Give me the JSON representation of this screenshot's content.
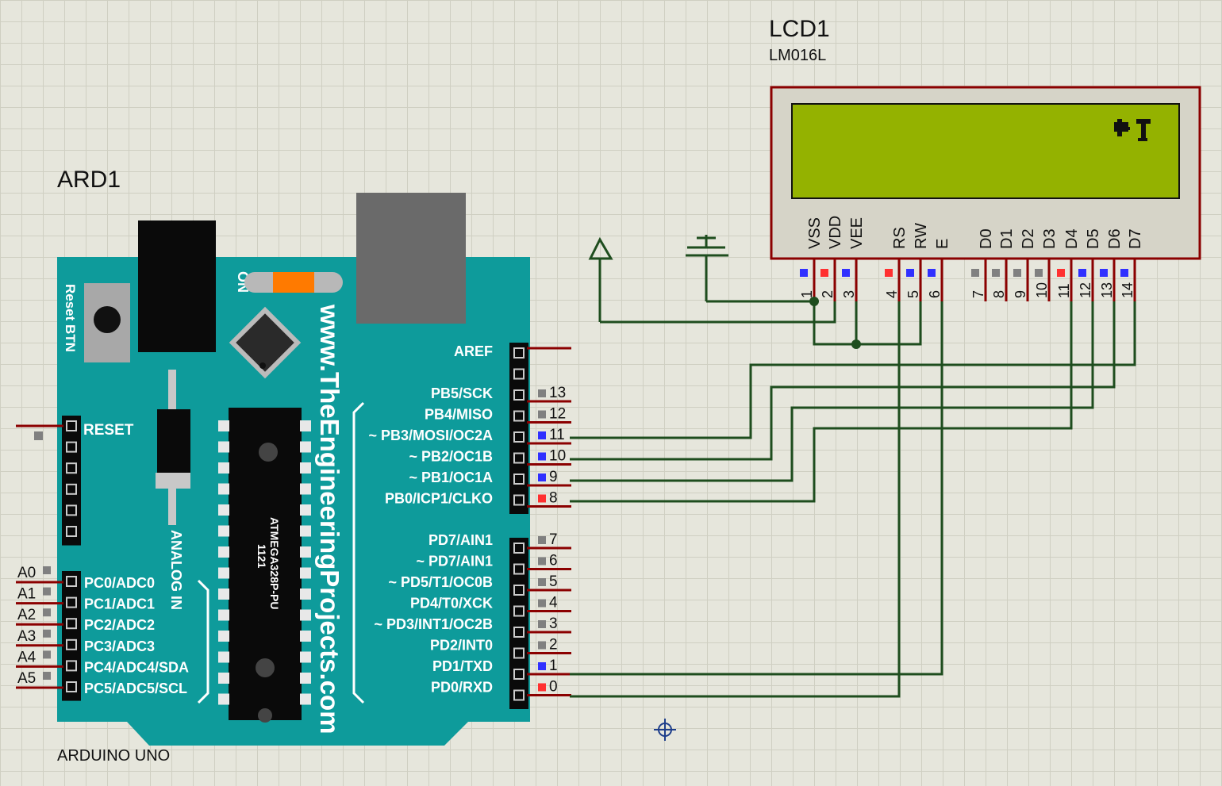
{
  "arduino": {
    "ref": "ARD1",
    "model": "ARDUINO UNO",
    "reset_btn": "Reset BTN",
    "power_label": "ON",
    "website": "www.TheEngineeringProjects.com",
    "chip_line1": "1121",
    "chip_line2": "ATMEGA328P-PU",
    "analog_in": "ANALOG IN",
    "reset_pin": "RESET",
    "digital_header_top": [
      {
        "label": "AREF",
        "num": ""
      },
      {
        "label": "",
        "num": ""
      },
      {
        "label": "PB5/SCK",
        "num": "13"
      },
      {
        "label": "PB4/MISO",
        "num": "12"
      },
      {
        "label": "~ PB3/MOSI/OC2A",
        "num": "11"
      },
      {
        "label": "~ PB2/OC1B",
        "num": "10"
      },
      {
        "label": "~ PB1/OC1A",
        "num": "9"
      },
      {
        "label": "PB0/ICP1/CLKO",
        "num": "8"
      }
    ],
    "digital_header_bottom": [
      {
        "label": "PD7/AIN1",
        "num": "7"
      },
      {
        "label": "~ PD7/AIN1",
        "num": "6"
      },
      {
        "label": "~ PD5/T1/OC0B",
        "num": "5"
      },
      {
        "label": "PD4/T0/XCK",
        "num": "4"
      },
      {
        "label": "~ PD3/INT1/OC2B",
        "num": "3"
      },
      {
        "label": "PD2/INT0",
        "num": "2"
      },
      {
        "label": "PD1/TXD",
        "num": "1"
      },
      {
        "label": "PD0/RXD",
        "num": "0"
      }
    ],
    "analog_header": [
      {
        "label": "PC0/ADC0",
        "num": "A0"
      },
      {
        "label": "PC1/ADC1",
        "num": "A1"
      },
      {
        "label": "PC2/ADC2",
        "num": "A2"
      },
      {
        "label": "PC3/ADC3",
        "num": "A3"
      },
      {
        "label": "PC4/ADC4/SDA",
        "num": "A4"
      },
      {
        "label": "PC5/ADC5/SCL",
        "num": "A5"
      }
    ]
  },
  "lcd": {
    "ref": "LCD1",
    "model": "LM016L",
    "pins": [
      {
        "name": "VSS",
        "num": "1"
      },
      {
        "name": "VDD",
        "num": "2"
      },
      {
        "name": "VEE",
        "num": "3"
      },
      {
        "name": "RS",
        "num": "4"
      },
      {
        "name": "RW",
        "num": "5"
      },
      {
        "name": "E",
        "num": "6"
      },
      {
        "name": "D0",
        "num": "7"
      },
      {
        "name": "D1",
        "num": "8"
      },
      {
        "name": "D2",
        "num": "9"
      },
      {
        "name": "D3",
        "num": "10"
      },
      {
        "name": "D4",
        "num": "11"
      },
      {
        "name": "D5",
        "num": "12"
      },
      {
        "name": "D6",
        "num": "13"
      },
      {
        "name": "D7",
        "num": "14"
      }
    ]
  },
  "colors": {
    "board": "#0e9b9b",
    "wire": "#1e4d1e",
    "pin_stub": "#8b0000",
    "lcd_frame": "#d6d4c8",
    "lcd_screen": "#94b200",
    "state_high": "#ff3030",
    "state_low": "#3030ff",
    "state_float": "#808080"
  }
}
